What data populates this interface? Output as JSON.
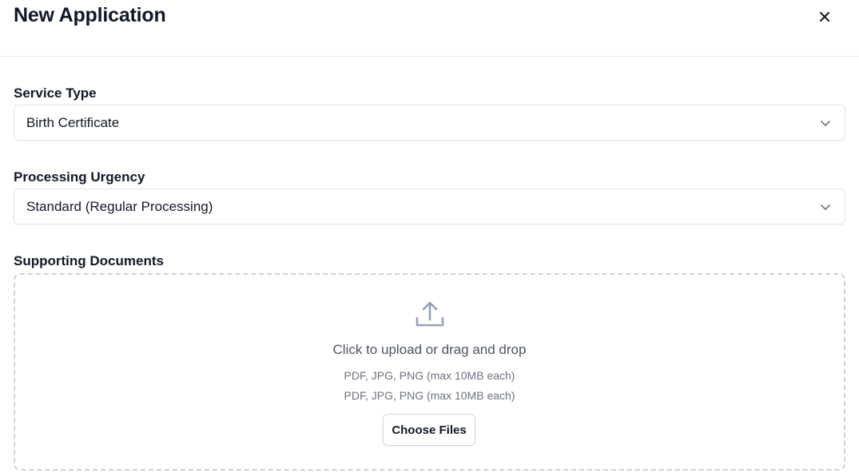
{
  "modal": {
    "title": "New Application",
    "close_icon": "close-icon"
  },
  "form": {
    "service_type": {
      "label": "Service Type",
      "value": "Birth Certificate",
      "icon": "chevron-down-icon"
    },
    "processing_urgency": {
      "label": "Processing Urgency",
      "value": "Standard (Regular Processing)",
      "icon": "chevron-down-icon"
    },
    "supporting_documents": {
      "label": "Supporting Documents",
      "icon": "upload-icon",
      "title": "Click to upload or drag and drop",
      "hint_1": "PDF, JPG, PNG (max 10MB each)",
      "hint_2": "PDF, JPG, PNG (max 10MB each)",
      "button_label": "Choose Files"
    }
  },
  "colors": {
    "text": "#111827",
    "muted": "#6b7280",
    "border": "#e2e5ea",
    "dashed_border": "#cbd2dc",
    "icon": "#94a3b8"
  }
}
